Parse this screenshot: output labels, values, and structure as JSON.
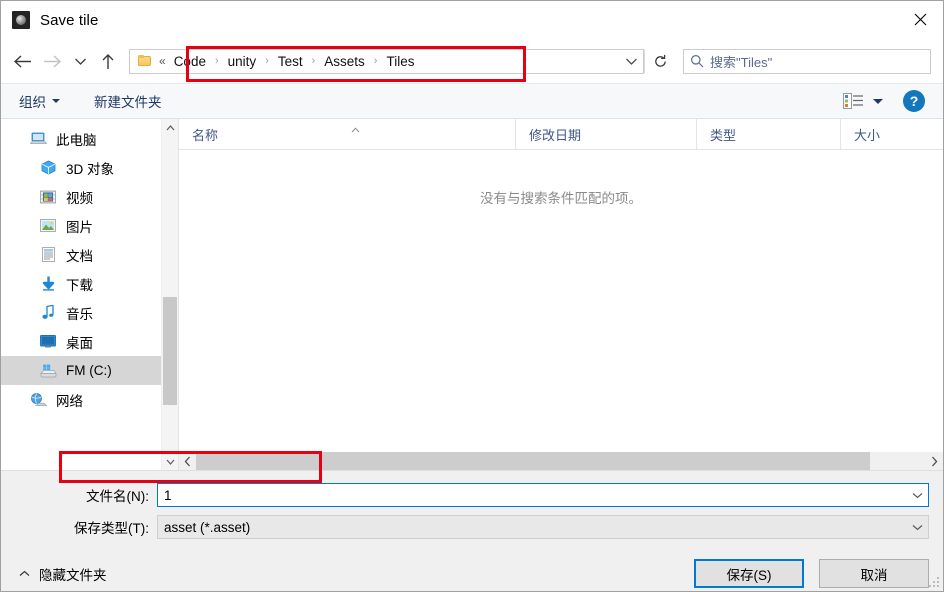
{
  "window": {
    "title": "Save tile",
    "app_icon": "unity-app-icon",
    "close_label": "close-icon"
  },
  "navigation": {
    "back": "back-arrow-icon",
    "forward": "forward-arrow-icon",
    "recent": "chevron-down-icon",
    "up": "up-arrow-icon"
  },
  "address": {
    "folder_icon": "folder-icon",
    "overflow": "«",
    "separator": "›",
    "crumbs": [
      "Code",
      "unity",
      "Test",
      "Assets",
      "Tiles"
    ],
    "dropdown_icon": "chevron-down-icon",
    "refresh_icon": "refresh-icon"
  },
  "search": {
    "icon": "search-icon",
    "placeholder": "搜索\"Tiles\""
  },
  "toolbar": {
    "organize_label": "组织",
    "new_folder_label": "新建文件夹",
    "view_icon": "list-view-icon",
    "view_caret": "chevron-down-icon",
    "help_label": "?",
    "help_icon": "help-icon"
  },
  "sidebar": {
    "items": [
      {
        "label": "此电脑",
        "icon": "this-pc-icon",
        "indent": false,
        "selected": false
      },
      {
        "label": "3D 对象",
        "icon": "3d-objects-icon",
        "indent": true,
        "selected": false
      },
      {
        "label": "视频",
        "icon": "videos-icon",
        "indent": true,
        "selected": false
      },
      {
        "label": "图片",
        "icon": "pictures-icon",
        "indent": true,
        "selected": false
      },
      {
        "label": "文档",
        "icon": "documents-icon",
        "indent": true,
        "selected": false
      },
      {
        "label": "下载",
        "icon": "downloads-icon",
        "indent": true,
        "selected": false
      },
      {
        "label": "音乐",
        "icon": "music-icon",
        "indent": true,
        "selected": false
      },
      {
        "label": "桌面",
        "icon": "desktop-icon",
        "indent": true,
        "selected": false
      },
      {
        "label": "FM (C:)",
        "icon": "local-disk-icon",
        "indent": true,
        "selected": true
      },
      {
        "label": "网络",
        "icon": "network-icon",
        "indent": false,
        "selected": false
      }
    ],
    "scroll_up_icon": "chevron-up-icon",
    "scroll_down_icon": "chevron-down-icon"
  },
  "filelist": {
    "columns": [
      {
        "label": "名称",
        "sorted": true
      },
      {
        "label": "修改日期",
        "sorted": false
      },
      {
        "label": "类型",
        "sorted": false
      },
      {
        "label": "大小",
        "sorted": false
      }
    ],
    "empty_message": "没有与搜索条件匹配的项。",
    "rows": [],
    "scroll_left_icon": "chevron-left-icon",
    "scroll_right_icon": "chevron-right-icon"
  },
  "form": {
    "filename_label": "文件名(N):",
    "filename_value": "1",
    "filetype_label": "保存类型(T):",
    "filetype_value": "asset (*.asset)",
    "combo_arrow_icon": "chevron-down-icon"
  },
  "footer": {
    "hide_folders_label": "隐藏文件夹",
    "hide_folders_icon": "chevron-up-icon",
    "save_label": "保存(S)",
    "cancel_label": "取消",
    "resize_grip": "resize-grip-icon"
  },
  "annotations": [
    {
      "name": "breadcrumb-highlight",
      "color": "#e60012"
    },
    {
      "name": "filename-highlight",
      "color": "#e60012"
    }
  ]
}
